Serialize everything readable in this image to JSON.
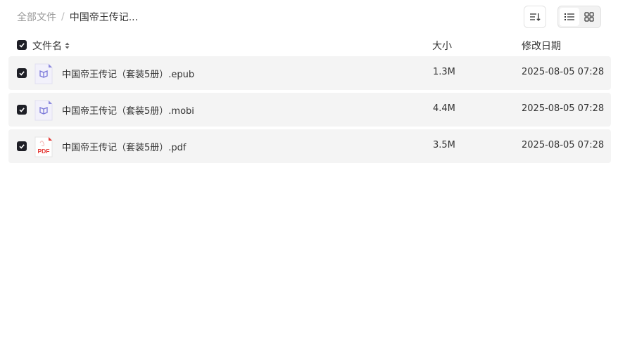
{
  "breadcrumb": {
    "root": "全部文件",
    "separator": "/",
    "current": "中国帝王传记..."
  },
  "toolbar": {
    "sort_icon": "sort-icon",
    "list_view_icon": "list-view-icon",
    "grid_view_icon": "grid-view-icon",
    "active_view": "list"
  },
  "table": {
    "headers": {
      "name": "文件名",
      "size": "大小",
      "modified": "修改日期"
    },
    "select_all_checked": true,
    "rows": [
      {
        "name": "中国帝王传记（套装5册）.epub",
        "size": "1.3M",
        "modified": "2025-08-05 07:28",
        "type": "ebook",
        "checked": true
      },
      {
        "name": "中国帝王传记（套装5册）.mobi",
        "size": "4.4M",
        "modified": "2025-08-05 07:28",
        "type": "ebook",
        "checked": true
      },
      {
        "name": "中国帝王传记（套装5册）.pdf",
        "size": "3.5M",
        "modified": "2025-08-05 07:28",
        "type": "pdf",
        "checked": true,
        "icon_label": "PDF"
      }
    ]
  },
  "colors": {
    "checkbox": "#1e1f26",
    "row_bg": "#f4f4f4",
    "ebook_icon": "#7b78d9",
    "pdf_icon": "#e53935",
    "muted_text": "#999999"
  }
}
